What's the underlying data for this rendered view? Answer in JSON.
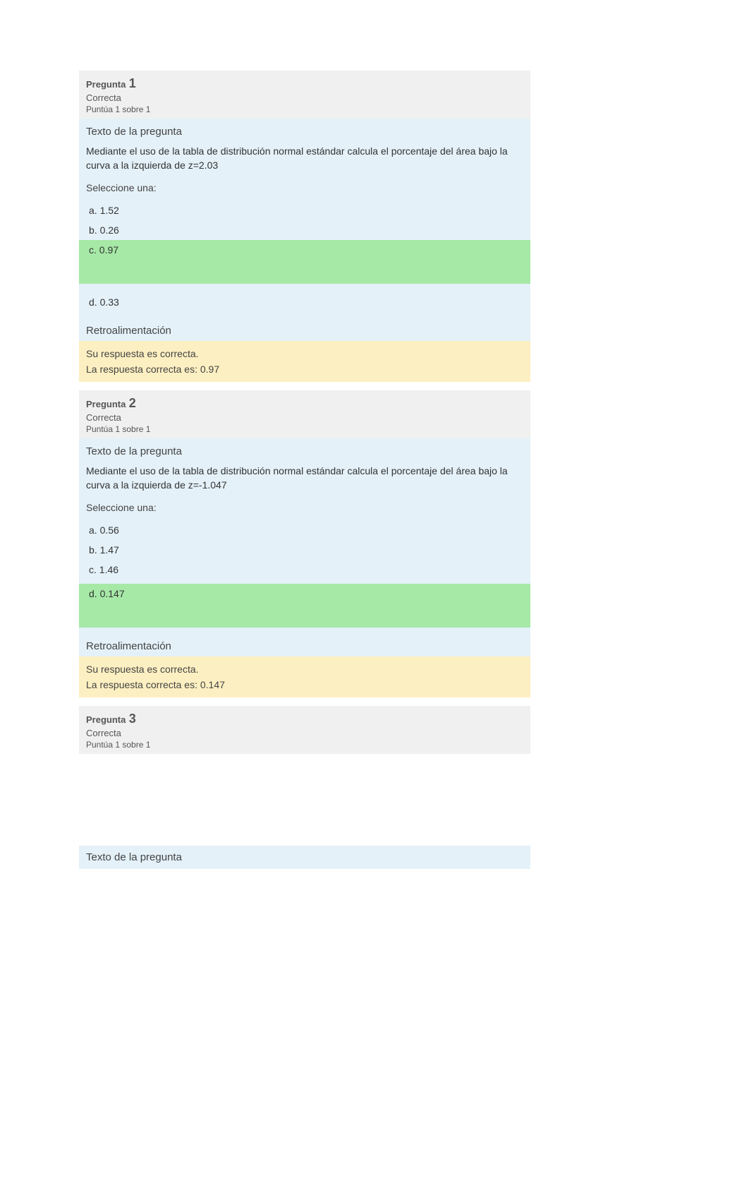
{
  "labels": {
    "pregunta": "Pregunta",
    "texto_pregunta": "Texto de la pregunta",
    "seleccione": "Seleccione una:",
    "retro": "Retroalimentación"
  },
  "questions": [
    {
      "number": "1",
      "state": "Correcta",
      "grade": "Puntúa 1 sobre 1",
      "prompt": "Mediante el uso de la tabla de distribución normal estándar calcula el porcentaje del área bajo la curva a la izquierda de z=2.03",
      "options": [
        {
          "letter": "a.",
          "text": "1.52",
          "correct": false
        },
        {
          "letter": "b.",
          "text": "0.26",
          "correct": false
        },
        {
          "letter": "c.",
          "text": "0.97",
          "correct": true
        },
        {
          "letter": "d.",
          "text": "0.33",
          "correct": false
        }
      ],
      "feedback_lines": [
        "Su respuesta es correcta.",
        "La respuesta correcta es: 0.97"
      ]
    },
    {
      "number": "2",
      "state": "Correcta",
      "grade": "Puntúa 1 sobre 1",
      "prompt": "Mediante el uso de la tabla de distribución normal estándar calcula el porcentaje del área bajo la curva a la izquierda de z=-1.047",
      "options": [
        {
          "letter": "a.",
          "text": "0.56",
          "correct": false
        },
        {
          "letter": "b.",
          "text": "1.47",
          "correct": false
        },
        {
          "letter": "c.",
          "text": "1.46",
          "correct": false
        },
        {
          "letter": "d.",
          "text": "0.147",
          "correct": true
        }
      ],
      "feedback_lines": [
        "Su respuesta es correcta.",
        "La respuesta correcta es: 0.147"
      ]
    },
    {
      "number": "3",
      "state": "Correcta",
      "grade": "Puntúa 1 sobre 1",
      "prompt": "",
      "options": [],
      "feedback_lines": []
    }
  ]
}
